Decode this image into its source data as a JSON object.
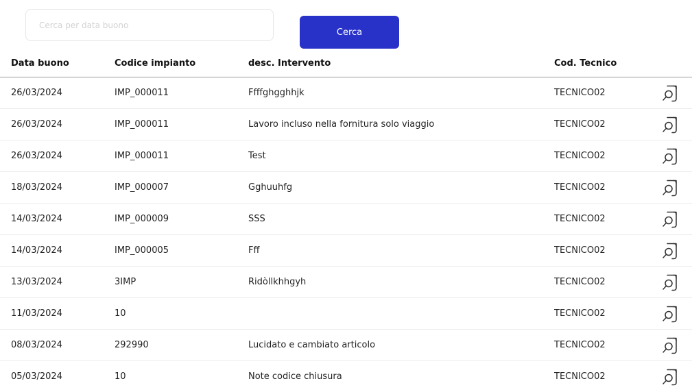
{
  "search": {
    "placeholder": "Cerca per data buono",
    "button_label": "Cerca"
  },
  "table": {
    "headers": {
      "date": "Data buono",
      "code": "Codice impianto",
      "desc": "desc. Intervento",
      "tech": "Cod. Tecnico"
    },
    "rows": [
      {
        "date": "26/03/2024",
        "code": "IMP_000011",
        "desc": "Ffffghgghhjk",
        "tech": "TECNICO02",
        "icon": "search-document-icon"
      },
      {
        "date": "26/03/2024",
        "code": "IMP_000011",
        "desc": "Lavoro incluso nella fornitura solo viaggio",
        "tech": "TECNICO02",
        "icon": "search-document-icon"
      },
      {
        "date": "26/03/2024",
        "code": "IMP_000011",
        "desc": "Test",
        "tech": "TECNICO02",
        "icon": "search-document-icon"
      },
      {
        "date": "18/03/2024",
        "code": "IMP_000007",
        "desc": "Gghuuhfg",
        "tech": "TECNICO02",
        "icon": "search-document-icon"
      },
      {
        "date": "14/03/2024",
        "code": "IMP_000009",
        "desc": "SSS",
        "tech": "TECNICO02",
        "icon": "search-document-icon"
      },
      {
        "date": "14/03/2024",
        "code": "IMP_000005",
        "desc": "Fff",
        "tech": "TECNICO02",
        "icon": "search-document-icon"
      },
      {
        "date": "13/03/2024",
        "code": "3IMP",
        "desc": "Ridòllkhhgyh",
        "tech": "TECNICO02",
        "icon": "search-document-icon"
      },
      {
        "date": "11/03/2024",
        "code": "10",
        "desc": "",
        "tech": "TECNICO02",
        "icon": "search-document-icon"
      },
      {
        "date": "08/03/2024",
        "code": "292990",
        "desc": "Lucidato e cambiato articolo",
        "tech": "TECNICO02",
        "icon": "search-document-icon"
      },
      {
        "date": "05/03/2024",
        "code": "10",
        "desc": "Note codice chiusura",
        "tech": "TECNICO02",
        "icon": "search-document-icon"
      }
    ]
  },
  "colors": {
    "accent": "#2832c8",
    "text": "#222222",
    "border": "#ececec"
  }
}
